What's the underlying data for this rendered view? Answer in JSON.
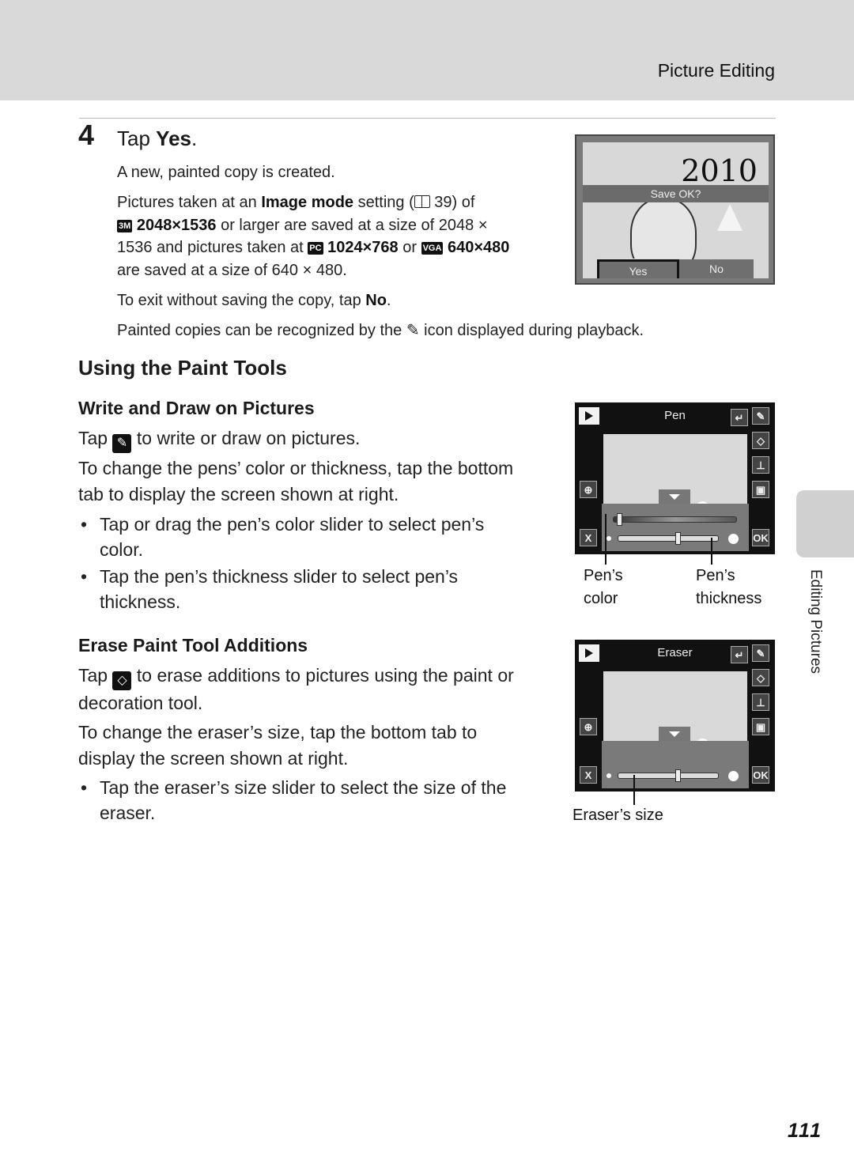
{
  "header": {
    "title": "Picture Editing"
  },
  "side_tab": {
    "label": "Editing Pictures"
  },
  "page_number": "111",
  "step4": {
    "number": "4",
    "title_prefix": "Tap ",
    "title_bold": "Yes",
    "title_suffix": ".",
    "line1": "A new, painted copy is created.",
    "para2": {
      "a": "Pictures taken at an ",
      "b_bold": "Image mode",
      "c": " setting (",
      "d": " 39) of",
      "icon1": "3M",
      "e_bold": " 2048×1536",
      "f": " or larger are saved at a size of 2048 ×",
      "g": "1536 and pictures taken at ",
      "icon2": "PC",
      "h_bold": " 1024×768",
      "i": " or ",
      "icon3": "VGA",
      "j_bold": " 640×480",
      "k": "are saved at a size of 640 × 480."
    },
    "exit_prefix": "To exit without saving the copy, tap ",
    "exit_bold": "No",
    "exit_suffix": ".",
    "painted_prefix": "Painted copies can be recognized by the ",
    "painted_suffix": " icon displayed during playback."
  },
  "save_screen": {
    "date_stamp": "2010",
    "prompt": "Save OK?",
    "yes_label": "Yes",
    "no_label": "No"
  },
  "section": {
    "title": "Using the Paint Tools"
  },
  "write_draw": {
    "title": "Write and Draw on Pictures",
    "tap_prefix": "Tap ",
    "tap_suffix": " to write or draw on pictures.",
    "para1_l1": "To change the pens’ color or thickness, tap the bottom",
    "para1_l2": "tab to display the screen shown at right.",
    "bullet1_l1": "Tap or drag the pen’s color slider to select pen’s",
    "bullet1_l2": "color.",
    "bullet2_l1": "Tap the pen’s thickness slider to select pen’s",
    "bullet2_l2": "thickness."
  },
  "pen_screen": {
    "title": "Pen",
    "back_icon": "↵",
    "ok_label": "OK",
    "cancel_label": "X",
    "color_slider_value": 0.05,
    "thickness_slider_value": 0.6,
    "callout_color_l1": "Pen’s",
    "callout_color_l2": "color",
    "callout_thickness_l1": "Pen’s",
    "callout_thickness_l2": "thickness"
  },
  "erase": {
    "title": "Erase Paint Tool Additions",
    "tap_prefix": "Tap ",
    "tap_suffix": " to erase additions to pictures using the paint or",
    "tap_l2": "decoration tool.",
    "para1_l1": "To change the eraser’s size, tap the bottom tab to",
    "para1_l2": "display the screen shown at right.",
    "bullet1_l1": "Tap the eraser’s size slider to select the size of the",
    "bullet1_l2": "eraser."
  },
  "eraser_screen": {
    "title": "Eraser",
    "back_icon": "↵",
    "ok_label": "OK",
    "cancel_label": "X",
    "size_slider_value": 0.6,
    "callout_size": "Eraser’s size"
  }
}
